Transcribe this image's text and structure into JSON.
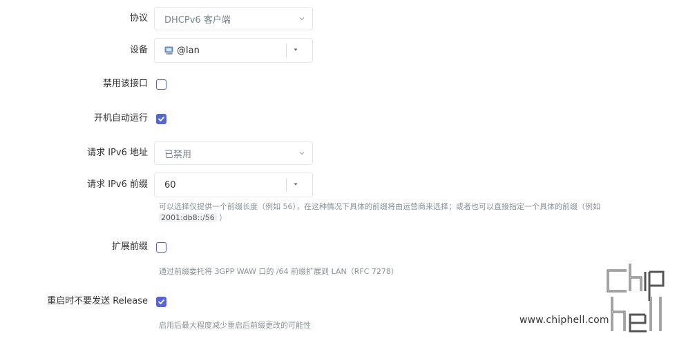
{
  "fields": {
    "protocol": {
      "label": "协议",
      "value": "DHCPv6 客户端"
    },
    "device": {
      "label": "设备",
      "value": "@lan"
    },
    "disable_interface": {
      "label": "禁用该接口",
      "checked": false
    },
    "autostart": {
      "label": "开机自动运行",
      "checked": true
    },
    "request_ipv6_address": {
      "label": "请求 IPv6 地址",
      "value": "已禁用"
    },
    "request_ipv6_prefix": {
      "label": "请求 IPv6 前缀",
      "value": "60",
      "help_before": "可以选择仅提供一个前缀长度（例如 56），在这种情况下具体的前缀将由运营商来选择；或者也可以直接指定一个具体的前缀（例如",
      "help_code": "2001:db8::/56",
      "help_after": "）"
    },
    "extend_prefix": {
      "label": "扩展前缀",
      "checked": false,
      "help": "通过前缀委托将 3GPP WAW 口的 /64 前缀扩展到 LAN（RFC 7278）"
    },
    "no_release": {
      "label": "重启时不要发送 Release",
      "checked": true,
      "help": "启用后最大程度减少重启后前缀更改的可能性"
    }
  },
  "watermark": {
    "url": "www.chiphell.com",
    "logo": "chip hell"
  },
  "colors": {
    "accent": "#5565d8",
    "help_text": "#8a9096",
    "border": "#e3e6ea"
  }
}
